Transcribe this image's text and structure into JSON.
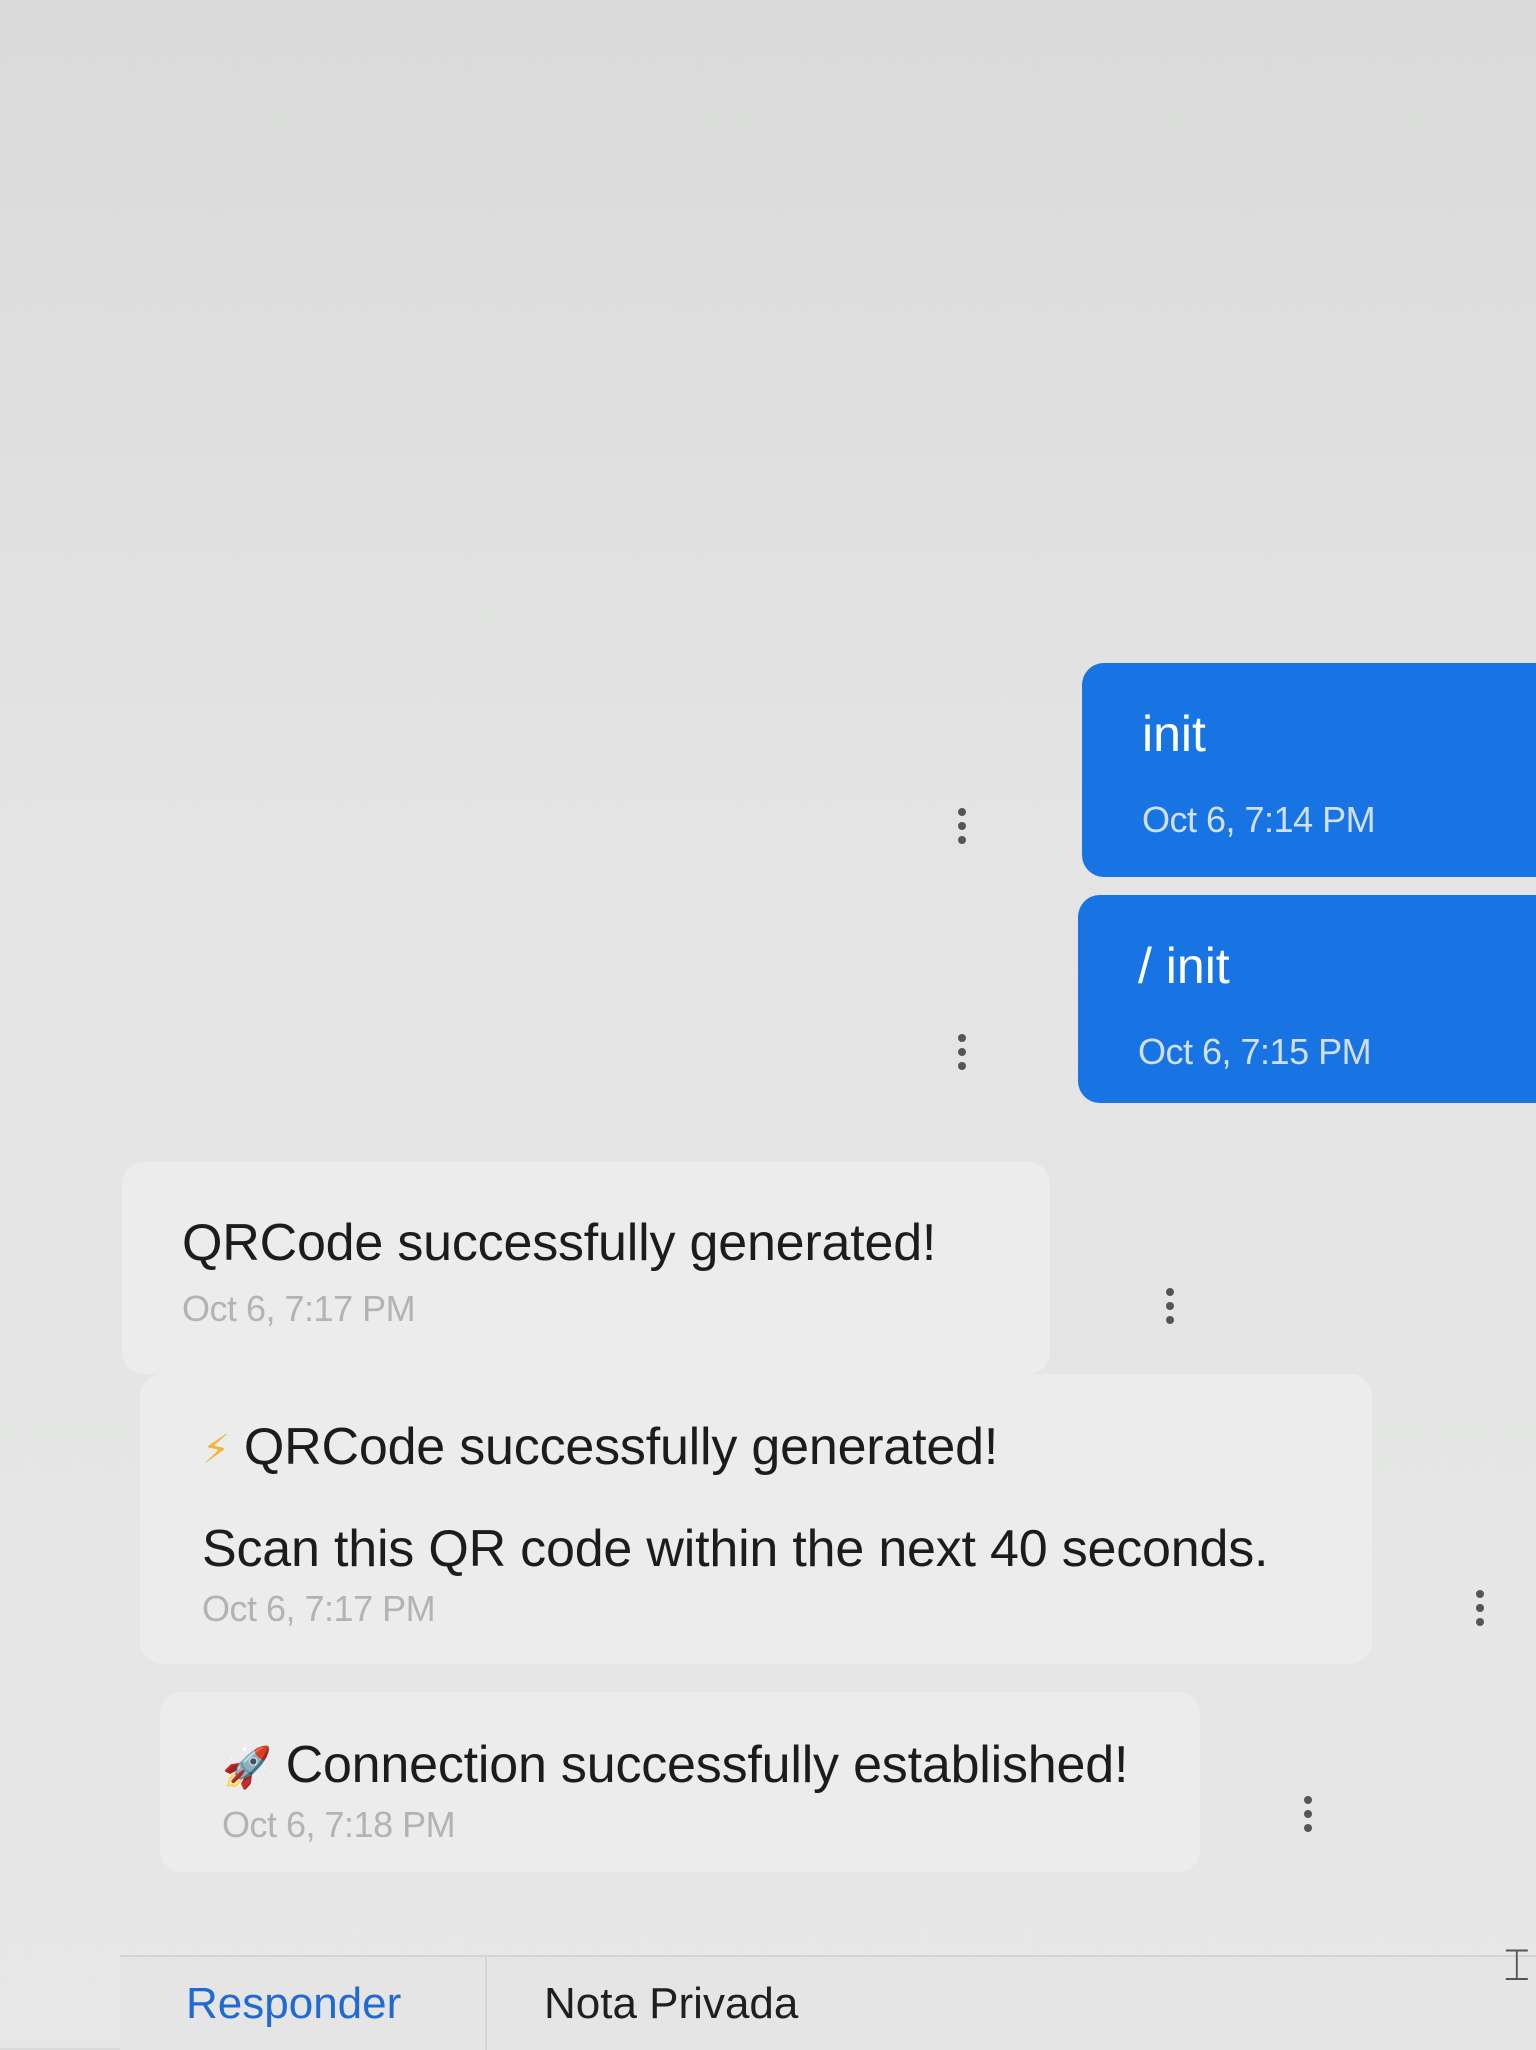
{
  "messages": [
    {
      "direction": "outgoing",
      "text": "init",
      "time": "Oct 6, 7:14 PM"
    },
    {
      "direction": "outgoing",
      "text": "/ init",
      "time": "Oct 6, 7:15 PM"
    },
    {
      "direction": "incoming",
      "text": "QRCode successfully generated!",
      "time": "Oct 6, 7:17 PM"
    },
    {
      "direction": "incoming",
      "icon": "lightning-bolt-icon",
      "icon_glyph": "⚡",
      "text": "QRCode successfully generated!",
      "text_line2": "Scan this QR code within the next 40 seconds.",
      "time": "Oct 6, 7:17 PM"
    },
    {
      "direction": "incoming",
      "icon": "rocket-icon",
      "icon_glyph": "🚀",
      "text": "Connection successfully established!",
      "time": "Oct 6, 7:18 PM"
    }
  ],
  "composer": {
    "tabs": [
      {
        "label": "Responder",
        "active": true
      },
      {
        "label": "Nota Privada",
        "active": false
      }
    ]
  },
  "colors": {
    "outgoing_bubble": "#1874e2",
    "incoming_bubble": "#ececec",
    "active_tab": "#1f6bd3"
  }
}
